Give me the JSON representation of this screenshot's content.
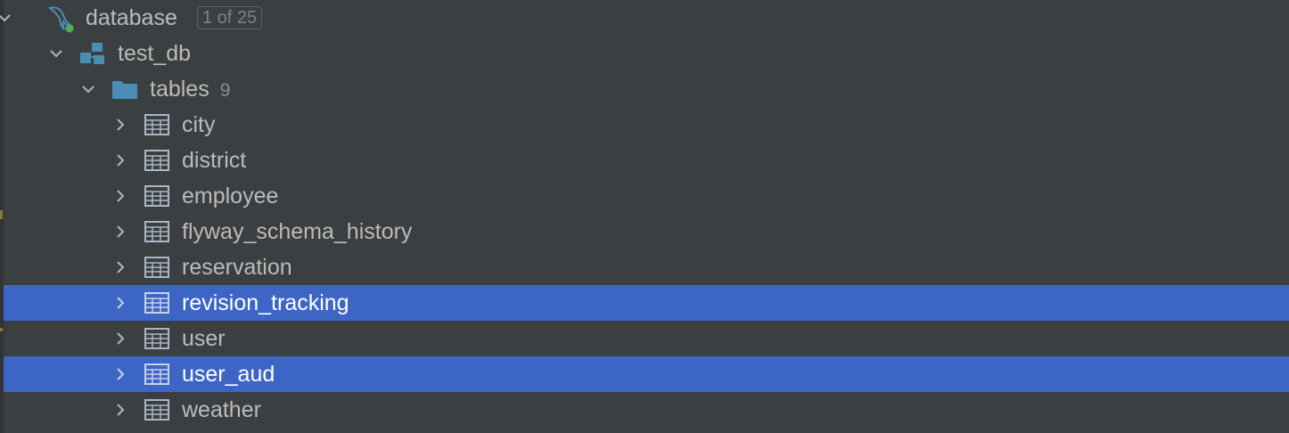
{
  "tree": {
    "connection": {
      "label": "database",
      "badge": "1 of 25",
      "icon": "mysql-dolphin-icon",
      "status_color": "#4caf50"
    },
    "schema": {
      "label": "test_db",
      "icon": "schema-icon"
    },
    "tables_folder": {
      "label": "tables",
      "count": "9",
      "icon": "folder-icon"
    },
    "tables": [
      {
        "label": "city",
        "selected": false
      },
      {
        "label": "district",
        "selected": false
      },
      {
        "label": "employee",
        "selected": false
      },
      {
        "label": "flyway_schema_history",
        "selected": false
      },
      {
        "label": "reservation",
        "selected": false
      },
      {
        "label": "revision_tracking",
        "selected": true
      },
      {
        "label": "user",
        "selected": false
      },
      {
        "label": "user_aud",
        "selected": true
      },
      {
        "label": "weather",
        "selected": false
      }
    ]
  },
  "colors": {
    "background": "#3c3f41",
    "selection": "#3c65c6",
    "text": "#bbbbbb",
    "icon_blue": "#4a8eb8"
  }
}
